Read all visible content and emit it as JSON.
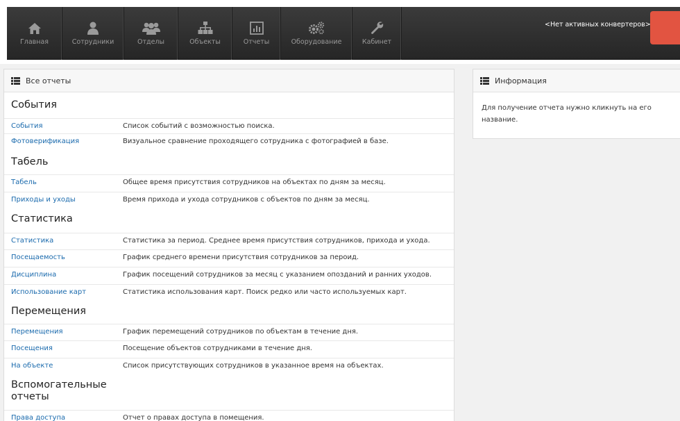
{
  "nav": {
    "items": [
      {
        "label": "Главная",
        "icon": "home-icon"
      },
      {
        "label": "Сотрудники",
        "icon": "user-icon"
      },
      {
        "label": "Отделы",
        "icon": "users-icon"
      },
      {
        "label": "Объекты",
        "icon": "sitemap-icon"
      },
      {
        "label": "Отчеты",
        "icon": "bar-chart-icon"
      },
      {
        "label": "Оборудование",
        "icon": "gears-icon"
      },
      {
        "label": "Кабинет",
        "icon": "wrench-icon"
      }
    ],
    "status": "<Нет активных конвертеров>",
    "accent_color": "#e25441"
  },
  "reports_panel": {
    "title": "Все отчеты",
    "sections": [
      {
        "title": "События",
        "items": [
          {
            "name": "События",
            "desc": "Список событий с возможностью поиска."
          },
          {
            "name": "Фотоверификация",
            "desc": "Визуальное сравнение проходящего сотрудника с фотографией в базе."
          }
        ]
      },
      {
        "title": "Табель",
        "items": [
          {
            "name": "Табель",
            "desc": "Общее время присутствия сотрудников на объектах по дням за месяц."
          },
          {
            "name": "Приходы и уходы",
            "desc": "Время прихода и ухода сотрудников с объектов по дням за месяц."
          }
        ]
      },
      {
        "title": "Статистика",
        "items": [
          {
            "name": "Статистика",
            "desc": "Статистика за период. Среднее время присутствия сотрудников, прихода и ухода."
          },
          {
            "name": "Посещаемость",
            "desc": "График среднего времени присутствия сотрудников за пероид."
          },
          {
            "name": "Дисциплина",
            "desc": "График посещений сотрудников за месяц с указанием опозданий и ранних уходов."
          },
          {
            "name": "Использование карт",
            "desc": "Статистика использования карт. Поиск редко или часто используемых карт."
          }
        ]
      },
      {
        "title": "Перемещения",
        "items": [
          {
            "name": "Перемещения",
            "desc": "График перемещений сотрудников по объектам в течение дня."
          },
          {
            "name": "Посещения",
            "desc": "Посещение объектов сотрудниками в течение дня."
          },
          {
            "name": "На объекте",
            "desc": "Список присутствующих сотрудников в указанное время на объектах."
          }
        ]
      },
      {
        "title_line1": "Вспомогательные",
        "title_line2": "отчеты",
        "items": [
          {
            "name": "Права доступа",
            "desc": "Отчет о правах доступа в помещения."
          }
        ]
      }
    ]
  },
  "info_panel": {
    "title": "Информация",
    "text_line1": "Для получение отчета нужно кликнуть на его",
    "text_line2": "название."
  }
}
